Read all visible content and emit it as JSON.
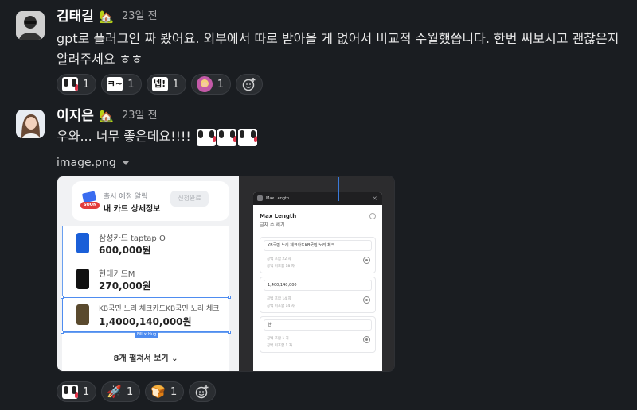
{
  "messages": [
    {
      "author": "김태길",
      "time": "23일 전",
      "text": "gpt로 플러그인 짜 봤어요. 외부에서 따로 받아올 게 없어서 비교적 수월했씁니다. 한번 써보시고 괜찮은지 알려주세요 ㅎㅎ",
      "reactions": [
        {
          "emoji": "face-emoji",
          "count": "1"
        },
        {
          "emoji": "text-emoji",
          "label": "ㅋ~",
          "count": "1"
        },
        {
          "emoji": "text-emoji",
          "label": "넵!",
          "count": "1"
        },
        {
          "emoji": "person-emoji",
          "count": "1"
        }
      ]
    },
    {
      "author": "이지은",
      "time": "23일 전",
      "text": "우와... 너무 좋은데요!!!!",
      "file_name": "image.png",
      "reactions": [
        {
          "emoji": "face-emoji",
          "count": "1"
        },
        {
          "emoji": "rocket-emoji",
          "count": "1"
        },
        {
          "emoji": "bread-emoji",
          "count": "1"
        }
      ]
    }
  ],
  "preview": {
    "top_card": {
      "badge": "SOON",
      "subtitle": "출시 예정 알림",
      "title": "내 카드 상세정보",
      "button": "신청완료"
    },
    "cards": [
      {
        "name": "삼성카드 taptap O",
        "amount": "600,000원",
        "color": "#1a5fd8"
      },
      {
        "name": "현대카드M",
        "amount": "270,000원",
        "color": "#111111"
      },
      {
        "name": "KB국민 노리 체크카드KB국민 노리 체크",
        "amount": "1,4000,140,000원",
        "color": "#5a4a2e"
      }
    ],
    "fill_tag": "Fill × Hug",
    "more_label": "8개 펼쳐서 보기",
    "dialog": {
      "header": "Max Length",
      "title": "Max Length",
      "subtitle": "글자 수 세기",
      "fields": [
        {
          "value": "KB국민 노리 체크카드KB국민 노리 체크",
          "stat1": "공백 포함 22 자",
          "stat2": "공백 미포함 18 자"
        },
        {
          "value": "1,400,140,000",
          "stat1": "공백 포함 14 자",
          "stat2": "공백 미포함 14 자"
        },
        {
          "value": "한",
          "stat1": "공백 포함 1 자",
          "stat2": "공백 미포함 1 자"
        }
      ]
    }
  },
  "colors": {
    "background": "#1a1d21",
    "reaction_bg": "#2a2d31",
    "selection": "#4e8cf0"
  }
}
